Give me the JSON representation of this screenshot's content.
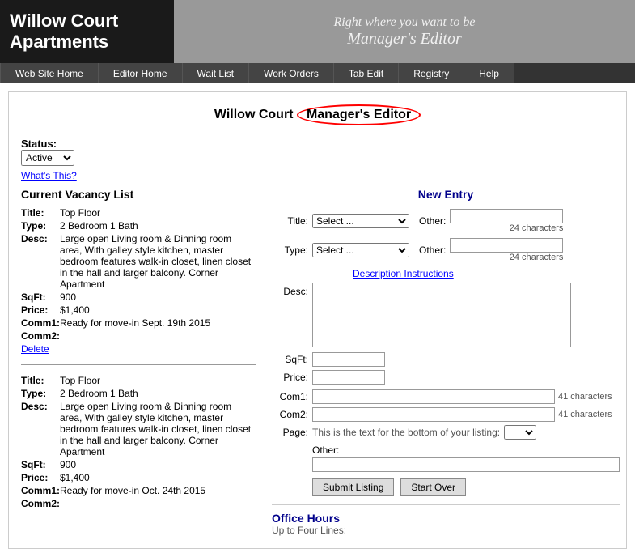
{
  "header": {
    "logo": "Willow Court Apartments",
    "banner_line1": "Right where you want to be",
    "banner_line2": "Manager's Editor"
  },
  "navbar": {
    "items": [
      {
        "label": "Web Site Home",
        "name": "web-site-home"
      },
      {
        "label": "Editor Home",
        "name": "editor-home"
      },
      {
        "label": "Wait List",
        "name": "wait-list"
      },
      {
        "label": "Work Orders",
        "name": "work-orders"
      },
      {
        "label": "Tab Edit",
        "name": "tab-edit"
      },
      {
        "label": "Registry",
        "name": "registry"
      },
      {
        "label": "Help",
        "name": "help"
      }
    ]
  },
  "page": {
    "title_left": "Willow Court ",
    "title_oval": "Manager's Editor",
    "status_label": "Status:",
    "status_value": "Active",
    "whats_this": "What's This?",
    "vacancy_list_title": "Current Vacancy List",
    "new_entry_title": "New Entry"
  },
  "vacancies": [
    {
      "title": "Top Floor",
      "type": "2 Bedroom 1 Bath",
      "desc": "Large open Living room & Dinning room area, With galley style kitchen, master bedroom features walk-in closet, linen closet in the hall and larger balcony. Corner Apartment",
      "sqft": "900",
      "price": "$1,400",
      "comm1": "Ready for move-in Sept. 19th 2015",
      "comm2": "",
      "has_delete": true
    },
    {
      "title": "Top Floor",
      "type": "2 Bedroom 1 Bath",
      "desc": "Large open Living room & Dinning room area, With galley style kitchen, master bedroom features walk-in closet, linen closet in the hall and larger balcony. Corner Apartment",
      "sqft": "900",
      "price": "$1,400",
      "comm1": "Ready for move-in Oct. 24th 2015",
      "comm2": "",
      "has_delete": false
    }
  ],
  "form": {
    "title_label": "Title:",
    "title_placeholder": "Select ...",
    "type_label": "Type:",
    "type_placeholder": "Select ...",
    "other_label": "Other:",
    "char24": "24 characters",
    "desc_label": "Desc:",
    "desc_instructions": "Description Instructions",
    "sqft_label": "SqFt:",
    "price_label": "Price:",
    "com1_label": "Com1:",
    "com2_label": "Com2:",
    "com_chars": "41 characters",
    "page_label": "Page:",
    "page_desc": "This is the text for the bottom of your listing:",
    "other_label2": "Other:",
    "submit_label": "Submit Listing",
    "start_over_label": "Start Over"
  },
  "office_hours": {
    "title": "Office Hours",
    "subtitle": "Up to Four Lines:"
  }
}
